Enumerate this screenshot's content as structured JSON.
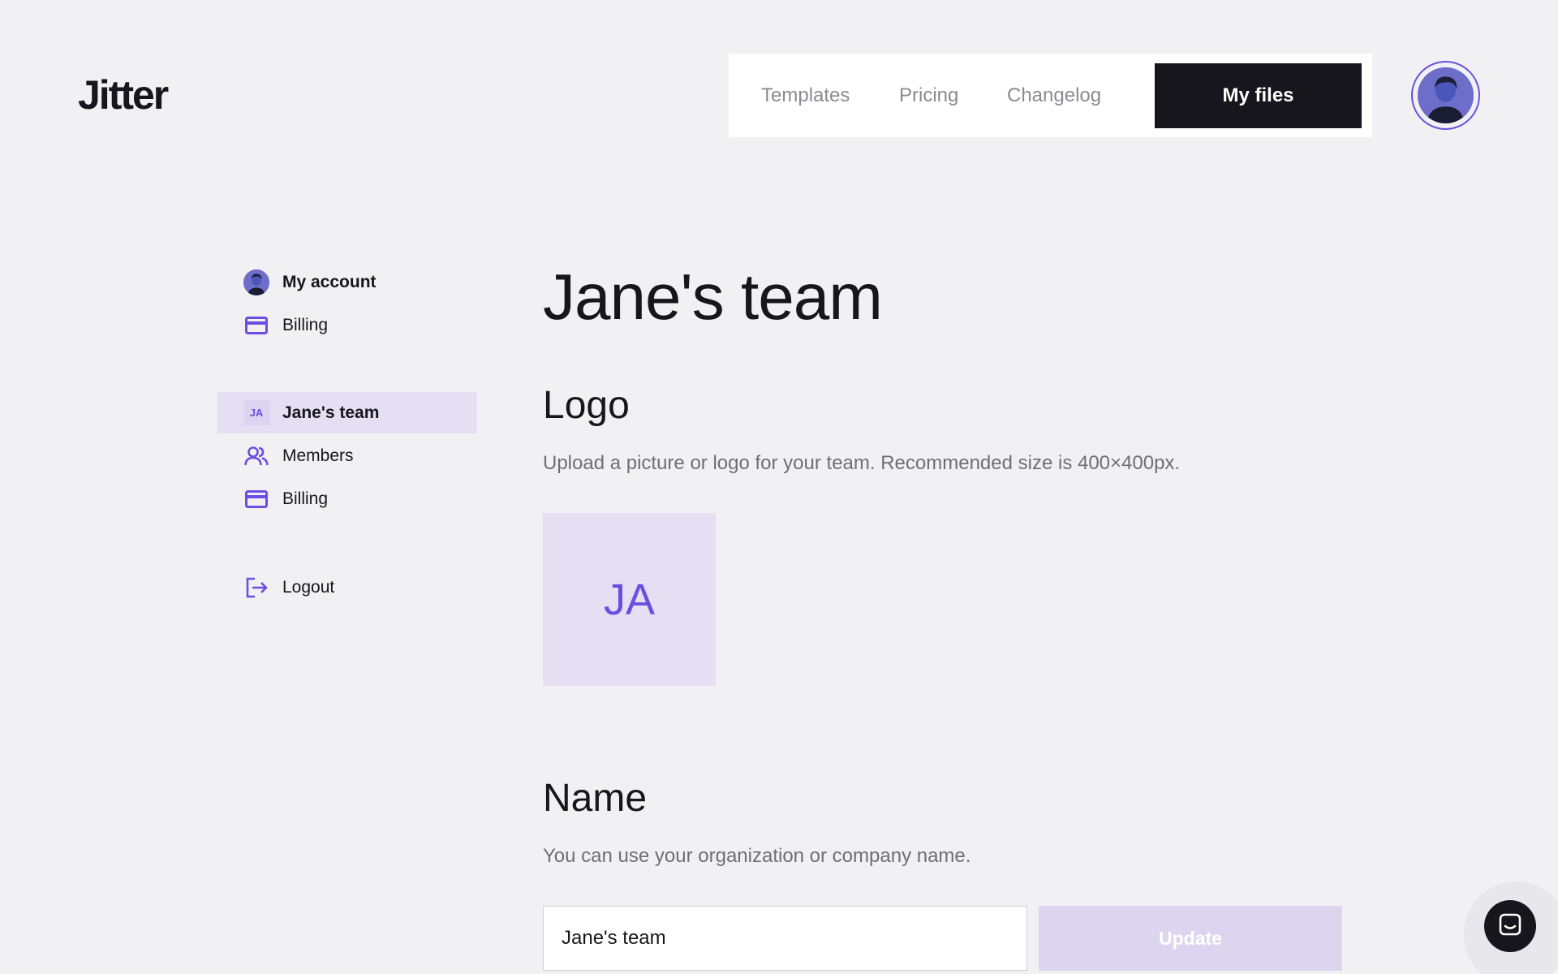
{
  "app": {
    "logo_text": "Jitter"
  },
  "header": {
    "nav": [
      {
        "label": "Templates"
      },
      {
        "label": "Pricing"
      },
      {
        "label": "Changelog"
      }
    ],
    "cta_label": "My files"
  },
  "sidebar": {
    "account_items": [
      {
        "label": "My account",
        "icon": "avatar"
      },
      {
        "label": "Billing",
        "icon": "credit-card-icon"
      }
    ],
    "team_items": [
      {
        "label": "Jane's team",
        "icon": "team-initials",
        "initials": "JA",
        "active": true
      },
      {
        "label": "Members",
        "icon": "users-icon"
      },
      {
        "label": "Billing",
        "icon": "credit-card-icon"
      }
    ],
    "logout_label": "Logout"
  },
  "main": {
    "title": "Jane's team",
    "logo_section": {
      "heading": "Logo",
      "description": "Upload a picture or logo for your team. Recommended size is 400×400px.",
      "initials": "JA"
    },
    "name_section": {
      "heading": "Name",
      "description": "You can use your organization or company name.",
      "input_value": "Jane's team",
      "update_label": "Update"
    }
  },
  "colors": {
    "accent": "#6b4fe0",
    "accent_light": "#e4dff2",
    "dark": "#17161c",
    "background": "#f1f1f4"
  }
}
